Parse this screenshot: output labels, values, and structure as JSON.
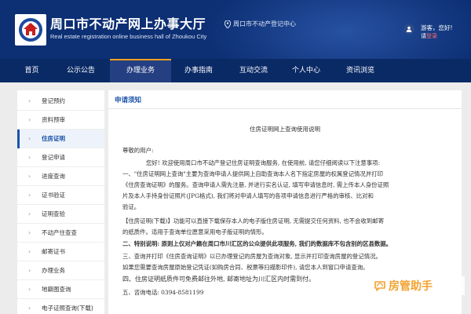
{
  "header": {
    "title": "周口市不动产网上办事大厅",
    "subtitle": "Real estate registration online business hall of Zhoukou City",
    "location": "周口市不动产登记中心",
    "user_greeting": "游客，您好!",
    "user_links_prefix": "请",
    "user_login": "登录"
  },
  "nav": {
    "items": [
      {
        "label": "首页",
        "active": false
      },
      {
        "label": "公示公告",
        "active": false
      },
      {
        "label": "办理业务",
        "active": true
      },
      {
        "label": "办事指南",
        "active": false
      },
      {
        "label": "互动交流",
        "active": false
      },
      {
        "label": "个人中心",
        "active": false
      },
      {
        "label": "资讯浏览",
        "active": false
      }
    ]
  },
  "sidebar": {
    "items": [
      {
        "label": "登记预约",
        "active": false
      },
      {
        "label": "资料预审",
        "active": false
      },
      {
        "label": "住房证明",
        "active": true
      },
      {
        "label": "登记申请",
        "active": false
      },
      {
        "label": "进度查询",
        "active": false
      },
      {
        "label": "证书验证",
        "active": false
      },
      {
        "label": "证明查验",
        "active": false
      },
      {
        "label": "不动产住查查",
        "active": false
      },
      {
        "label": "邮寄证书",
        "active": false
      },
      {
        "label": "办理业务",
        "active": false
      },
      {
        "label": "地籍图查询",
        "active": false
      },
      {
        "label": "电子证照查询(下载)",
        "active": false
      }
    ]
  },
  "main": {
    "section_title": "申请须知",
    "doc": {
      "title": "住房证明网上查询使用说明",
      "greeting": "尊敬的用户:",
      "p1": [
        "您好! 欢迎使用周口市不动产登记住房证明查询服务, 在使用前, 请您仔细阅读以下注意事项:",
        "一、\"住房证明网上查询\"主要为查询申请人提供网上自助查询本人名下指定房屋的权属登记情况并打印",
        "《住房查询证明》的服务。查询申请人需先注册, 并进行实名认证, 填写申请信息时, 需上传本人身份证照",
        "片及本人手持身份证照片(JPG格式), 我们将对申请人填写的各项申请信息进行严格的审核、比对和",
        "验证。"
      ],
      "p2": [
        "【住房证明(下载)】功能可以直接下载保存本人的电子版住房证明, 无需提交任何资料, 也不会收到邮寄",
        "的纸质件。适用于查询单位愿意采用电子版证明的情形。"
      ],
      "p3": "二、特别说明: 原则上仅对户籍在周口市川汇区的公众提供此项服务, 我们的数据库不包含别的区县数据。",
      "p4": [
        "三、查询并打印《住房查询证明》以已办理登记的房屋为查询对象, 显示并打印查询房屋的登记情况。",
        "如果您需要查询房屋原始登记凭证(如购房合同、税票等扫描影印件), 请您本人到窗口申请查询。"
      ],
      "p5": "四、住房证明纸质件可免费邮往外地, 邮寄地址为川汇区内时需到付。",
      "p6": "五、咨询电话: 0394-8581199"
    }
  },
  "watermark": {
    "text": "房管助手"
  },
  "colors": {
    "header_bg": "#0d2f74",
    "nav_bg": "#0a2a66",
    "nav_active_bg": "#243f82",
    "nav_active_border": "#f0a020",
    "accent_blue": "#1a53a8",
    "login_red": "#ff6a6a",
    "watermark_orange": "#f2a22f"
  },
  "icons": {
    "logo": "government-emblem-logo",
    "location": "map-pin-icon",
    "user": "user-avatar-icon",
    "sidebar_chevron": "chevron-right-icon",
    "watermark": "house-chat-icon"
  }
}
